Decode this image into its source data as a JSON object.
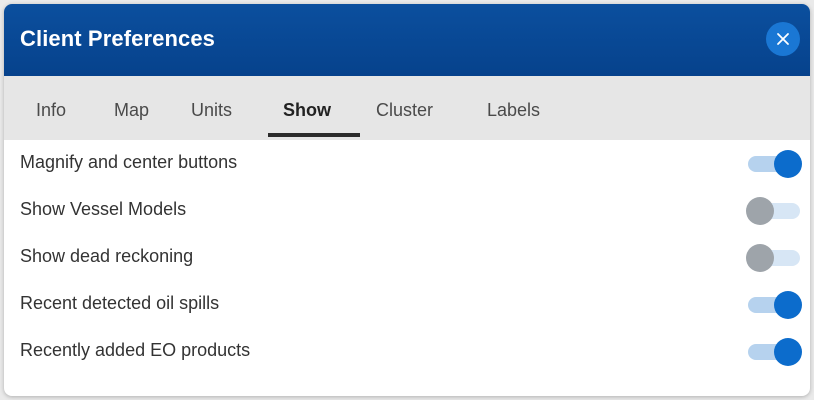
{
  "dialog": {
    "title": "Client Preferences",
    "close_icon": "close-icon"
  },
  "tabs": [
    {
      "label": "Info",
      "active": false
    },
    {
      "label": "Map",
      "active": false
    },
    {
      "label": "Units",
      "active": false
    },
    {
      "label": "Show",
      "active": true
    },
    {
      "label": "Cluster",
      "active": false
    },
    {
      "label": "Labels",
      "active": false
    }
  ],
  "settings": [
    {
      "label": "Magnify and center buttons",
      "enabled": true
    },
    {
      "label": "Show Vessel Models",
      "enabled": false
    },
    {
      "label": "Show dead reckoning",
      "enabled": false
    },
    {
      "label": "Recent detected oil spills",
      "enabled": true
    },
    {
      "label": "Recently added EO products",
      "enabled": true
    }
  ],
  "colors": {
    "header": "#06428c",
    "close_button": "#1a77d4",
    "toggle_on": "#0c6ccc",
    "toggle_off": "#9ea4aa"
  }
}
